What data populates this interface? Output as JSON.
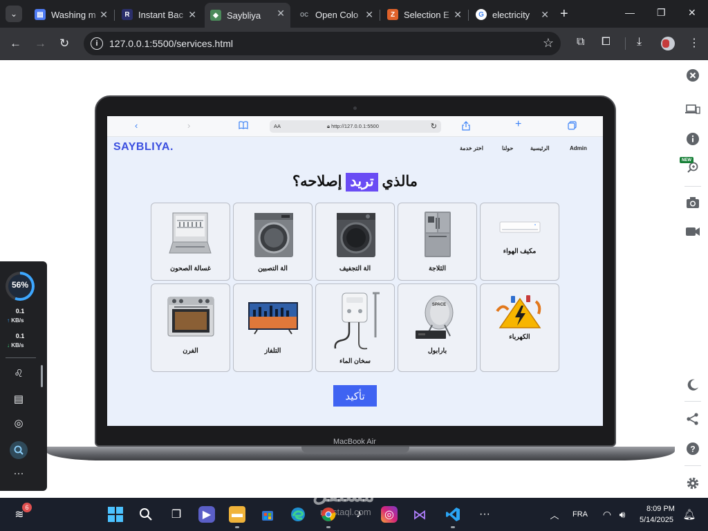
{
  "browser": {
    "tabs": [
      {
        "title": "Washing m",
        "favicon": "doc-icon",
        "color": "#4f7cf5"
      },
      {
        "title": "Instant Bac",
        "favicon": "r-logo-icon",
        "color": "#2b2f6b"
      },
      {
        "title": "Saybliya",
        "favicon": "saybliya-icon",
        "color": "#4b8a5a",
        "active": true
      },
      {
        "title": "Open Colo",
        "favicon": "oc-icon",
        "color": "#5f6368"
      },
      {
        "title": "Selection E",
        "favicon": "z-logo-icon",
        "color": "#e0622a"
      },
      {
        "title": "electricity",
        "favicon": "google-icon",
        "color": "#ffffff"
      }
    ],
    "address": "127.0.0.1:5500/services.html"
  },
  "inner_browser": {
    "aa_label": "AA",
    "address": "http://127.0.0.1:5500"
  },
  "site": {
    "logo": "SAYBLIYA.",
    "nav": {
      "admin": "Admin",
      "home": "الرئيسية",
      "about": "حولنا",
      "choose_service": "اختر خدمة"
    },
    "headline": {
      "before": "مالذي",
      "highlight": "تريد",
      "after": "إصلاحه؟"
    },
    "services_row1": [
      {
        "label": "مكيف الهواء",
        "icon": "air-conditioner-icon"
      },
      {
        "label": "الثلاجة",
        "icon": "refrigerator-icon"
      },
      {
        "label": "الة التجفيف",
        "icon": "dryer-icon"
      },
      {
        "label": "الة التصبين",
        "icon": "washing-machine-icon"
      },
      {
        "label": "غسالة الصحون",
        "icon": "dishwasher-icon"
      }
    ],
    "services_row2": [
      {
        "label": "الكهرباء",
        "icon": "electricity-icon"
      },
      {
        "label": "بارابول",
        "icon": "satellite-dish-icon"
      },
      {
        "label": "سخان الماء",
        "icon": "water-heater-icon"
      },
      {
        "label": "التلفاز",
        "icon": "tv-icon"
      },
      {
        "label": "الفرن",
        "icon": "oven-icon"
      }
    ],
    "confirm_label": "تأكيد"
  },
  "laptop": {
    "brand": "MacBook Air"
  },
  "net_widget": {
    "usage": "56%",
    "upload_value": "0.1",
    "upload_unit": "KB/s",
    "download_value": "0.1",
    "download_unit": "KB/s"
  },
  "side_panel": {
    "new_badge": "NEW"
  },
  "taskbar": {
    "notification_count": "6",
    "language": "FRA",
    "time": "8:09 PM",
    "date": "5/14/2025"
  },
  "watermark": {
    "text": "مستقل",
    "sub": "mostaql.com"
  }
}
